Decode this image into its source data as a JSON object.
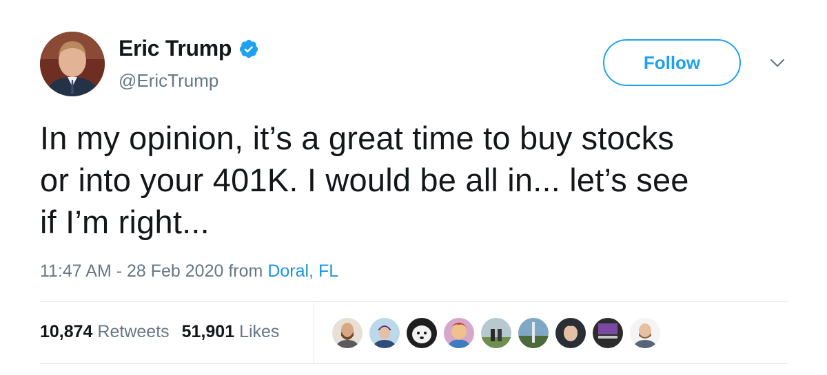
{
  "author": {
    "display_name": "Eric Trump",
    "handle": "@EricTrump",
    "verified": true,
    "verified_icon": "verified-badge-icon"
  },
  "actions": {
    "follow_label": "Follow",
    "more_icon": "chevron-down-icon"
  },
  "tweet": {
    "lines": [
      "In my opinion, it’s a great time to buy stocks",
      "or into your 401K. I would be all in... let’s see",
      "if I’m right..."
    ],
    "time": "11:47 AM",
    "separator": " - ",
    "date": "28 Feb 2020",
    "from_label": "from",
    "location": "Doral, FL"
  },
  "stats": {
    "retweets_count": "10,874",
    "retweets_label": "Retweets",
    "likes_count": "51,901",
    "likes_label": "Likes"
  },
  "likers": [
    "liker-avatar",
    "liker-avatar",
    "liker-avatar",
    "liker-avatar",
    "liker-avatar",
    "liker-avatar",
    "liker-avatar",
    "liker-avatar",
    "liker-avatar"
  ],
  "colors": {
    "twitter_blue": "#1da1f2",
    "link_blue": "#1b95e0",
    "text": "#14171a",
    "secondary_text": "#657786",
    "divider": "#e1e8ed"
  }
}
